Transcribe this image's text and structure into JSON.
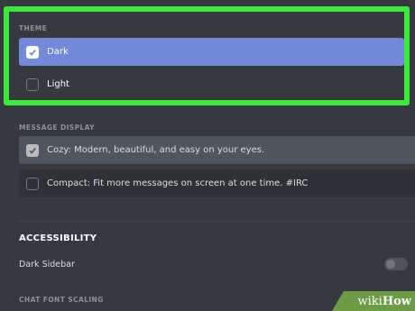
{
  "theme": {
    "section_label": "THEME",
    "options": [
      {
        "label": "Dark",
        "checked": true
      },
      {
        "label": "Light",
        "checked": false
      }
    ]
  },
  "message_display": {
    "section_label": "MESSAGE DISPLAY",
    "options": [
      {
        "label": "Cozy: Modern, beautiful, and easy on your eyes.",
        "checked": true
      },
      {
        "label": "Compact: Fit more messages on screen at one time. #IRC",
        "checked": false
      }
    ]
  },
  "accessibility": {
    "heading": "ACCESSIBILITY",
    "dark_sidebar_label": "Dark Sidebar",
    "dark_sidebar_on": false
  },
  "chat_font_scaling": {
    "section_label": "CHAT FONT SCALING"
  },
  "watermark": {
    "part1": "wiki",
    "part2": "How"
  },
  "colors": {
    "selected": "#7289da",
    "highlight": "#3de83d",
    "background": "#36393f"
  }
}
